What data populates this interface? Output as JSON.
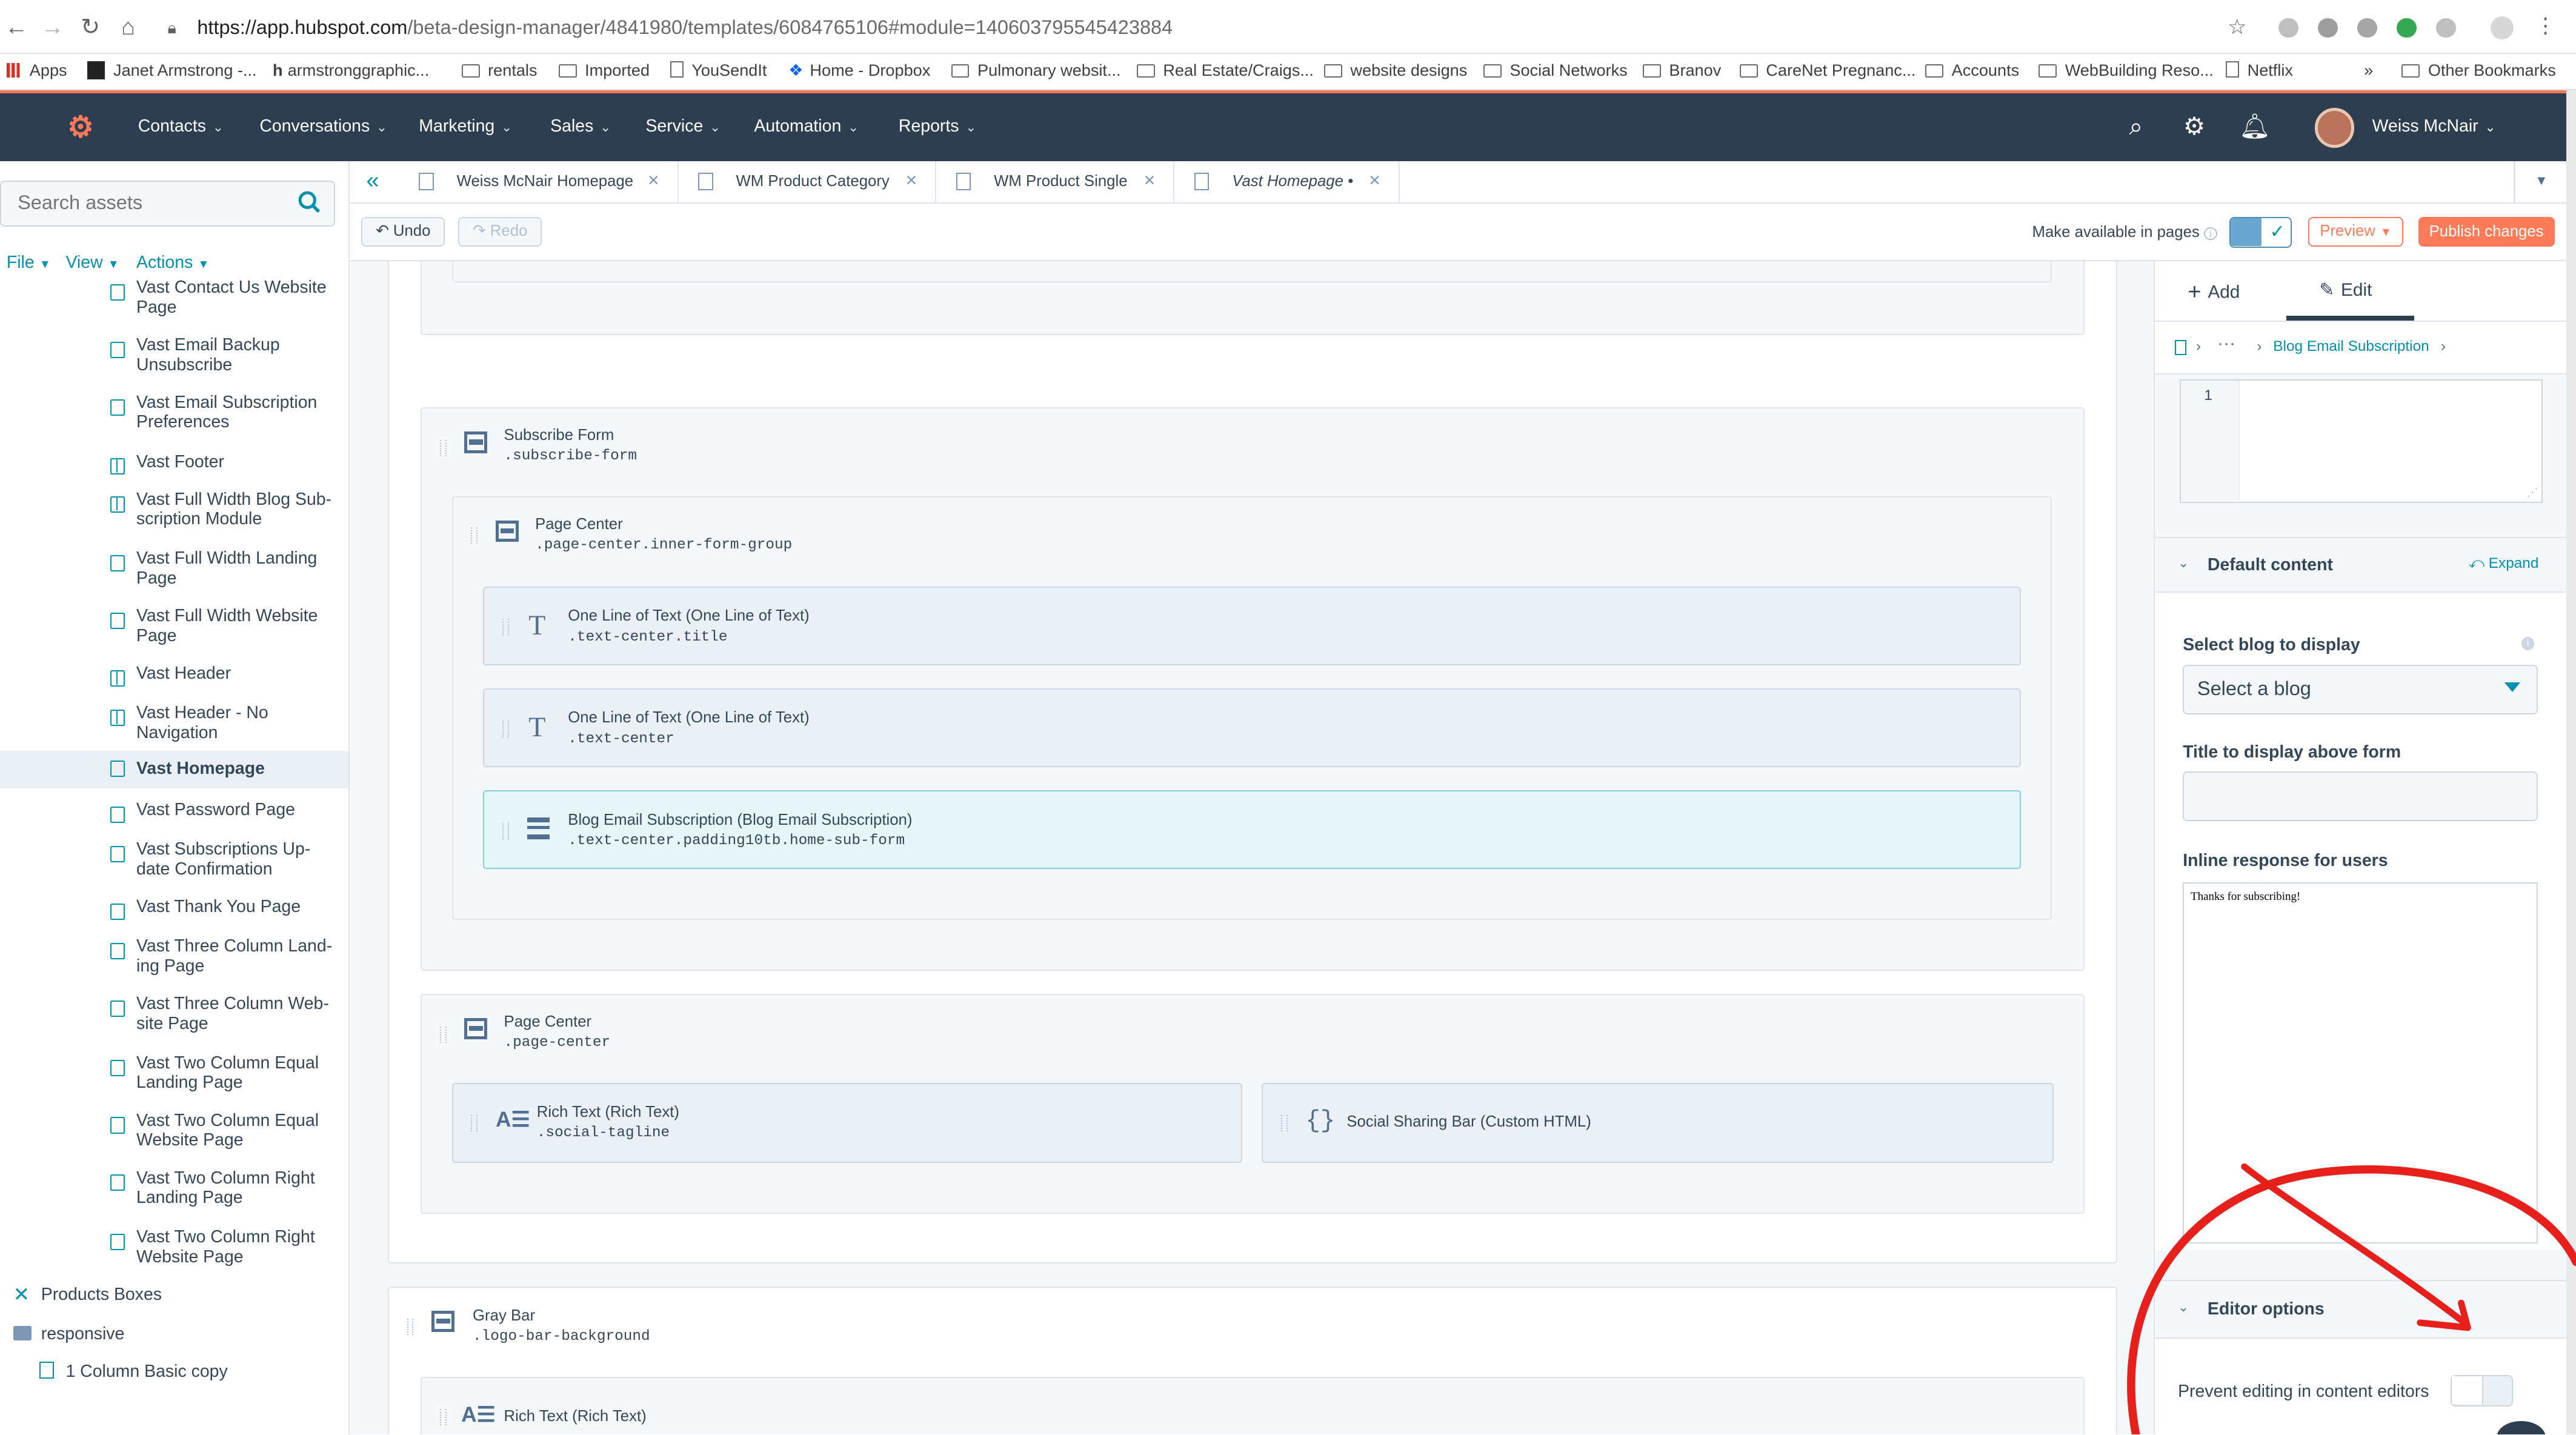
{
  "browser": {
    "url_host": "https://app.hubspot.com",
    "url_path": "/beta-design-manager/4841980/templates/6084765106#module=1406037955454238​84",
    "bookmarks": [
      "Apps",
      "Janet Armstrong -...",
      "armstronggraphic...",
      "rentals",
      "Imported",
      "YouSendIt",
      "Home - Dropbox",
      "Pulmonary websit...",
      "Real Estate/Craigs...",
      "website designs",
      "Social Networks",
      "Branov",
      "CareNet Pregnanc...",
      "Accounts",
      "WebBuilding Reso...",
      "Netflix",
      "»",
      "Other Bookmarks"
    ]
  },
  "nav": {
    "items": [
      "Contacts",
      "Conversations",
      "Marketing",
      "Sales",
      "Service",
      "Automation",
      "Reports"
    ],
    "user": "Weiss McNair"
  },
  "sidebar": {
    "search_placeholder": "Search assets",
    "menus": [
      "File",
      "View",
      "Actions"
    ],
    "items": [
      {
        "label": "Vast Contact Us Website Page",
        "icon": "page-icon"
      },
      {
        "label": "Vast Email Backup Unsubscribe",
        "icon": "page-icon"
      },
      {
        "label": "Vast Email Subscription Preferences",
        "icon": "page-icon"
      },
      {
        "label": "Vast Footer",
        "icon": "grid-icon"
      },
      {
        "label": "Vast Full Width Blog Sub-scription Module",
        "icon": "grid-icon"
      },
      {
        "label": "Vast Full Width Landing Page",
        "icon": "page-icon"
      },
      {
        "label": "Vast Full Width Website Page",
        "icon": "page-icon"
      },
      {
        "label": "Vast Header",
        "icon": "grid-icon"
      },
      {
        "label": "Vast Header - No Navigation",
        "icon": "grid-icon"
      },
      {
        "label": "Vast Homepage",
        "icon": "page-icon",
        "selected": true
      },
      {
        "label": "Vast Password Page",
        "icon": "page-icon"
      },
      {
        "label": "Vast Subscriptions Up-date Confirmation",
        "icon": "page-icon"
      },
      {
        "label": "Vast Thank You Page",
        "icon": "page-icon"
      },
      {
        "label": "Vast Three Column Land-ing Page",
        "icon": "page-icon"
      },
      {
        "label": "Vast Three Column Web-site Page",
        "icon": "page-icon"
      },
      {
        "label": "Vast Two Column Equal Landing Page",
        "icon": "page-icon"
      },
      {
        "label": "Vast Two Column Equal Website Page",
        "icon": "page-icon"
      },
      {
        "label": "Vast Two Column Right Landing Page",
        "icon": "page-icon"
      },
      {
        "label": "Vast Two Column Right Website Page",
        "icon": "page-icon"
      }
    ],
    "products_boxes": "Products Boxes",
    "responsive": "responsive",
    "basic_copy": "1 Column Basic copy"
  },
  "tabs": [
    {
      "label": "Weiss McNair Homepage"
    },
    {
      "label": "WM Product Category"
    },
    {
      "label": "WM Product Single"
    },
    {
      "label": "Vast Homepage •",
      "active": true
    }
  ],
  "toolbar": {
    "undo": "Undo",
    "redo": "Redo",
    "make_available": "Make available in pages",
    "preview": "Preview",
    "publish": "Publish changes"
  },
  "canvas": {
    "subscribe_form": {
      "name": "Subscribe Form",
      "cls": ".subscribe-form"
    },
    "page_center_1": {
      "name": "Page Center",
      "cls": ".page-center.inner-form-group"
    },
    "text_title": {
      "name": "One Line of Text (One Line of Text)",
      "cls": ".text-center.title"
    },
    "text_center": {
      "name": "One Line of Text (One Line of Text)",
      "cls": ".text-center"
    },
    "blog_email": {
      "name": "Blog Email Subscription (Blog Email Subscription)",
      "cls": ".text-center.padding10tb.home-sub-form"
    },
    "page_center_2": {
      "name": "Page Center",
      "cls": ".page-center"
    },
    "rich_text": {
      "name": "Rich Text (Rich Text)",
      "cls": ".social-tagline"
    },
    "social_bar": {
      "name": "Social Sharing Bar (Custom HTML)"
    },
    "gray_bar": {
      "name": "Gray Bar",
      "cls": ".logo-bar-background"
    },
    "rich_text_2": {
      "name": "Rich Text (Rich Text)"
    }
  },
  "panel": {
    "add": "Add",
    "edit": "Edit",
    "crumb": "Blog Email Subscription",
    "line_no": "1",
    "default_content": "Default content",
    "expand": "Expand",
    "select_blog_label": "Select blog to display",
    "select_blog_value": "Select a blog",
    "title_label": "Title to display above form",
    "inline_label": "Inline response for users",
    "inline_value": "Thanks for subscribing!",
    "editor_options": "Editor options",
    "prevent_editing": "Prevent editing in content editors"
  },
  "colors": {
    "accent": "#ff7a59",
    "nav_bg": "#2d3e50",
    "link": "#0091ae",
    "annotation": "#e8201b"
  }
}
